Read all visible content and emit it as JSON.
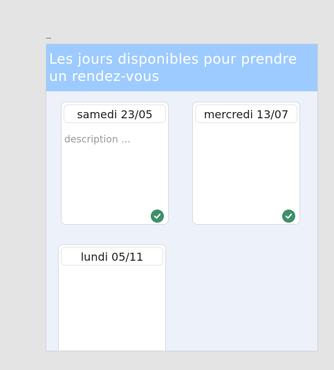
{
  "top_indicator": "...",
  "panel": {
    "title": "Les jours disponibles pour prendre un rendez-vous"
  },
  "cards": [
    {
      "date": "samedi 23/05",
      "description_placeholder": "description ...",
      "checked": true
    },
    {
      "date": "mercredi 13/07",
      "checked": true
    },
    {
      "date": "lundi 05/11",
      "checked": false
    }
  ],
  "colors": {
    "header": "#9ecbff",
    "panel_background": "#edf1f9",
    "check": "#3f8f69"
  }
}
